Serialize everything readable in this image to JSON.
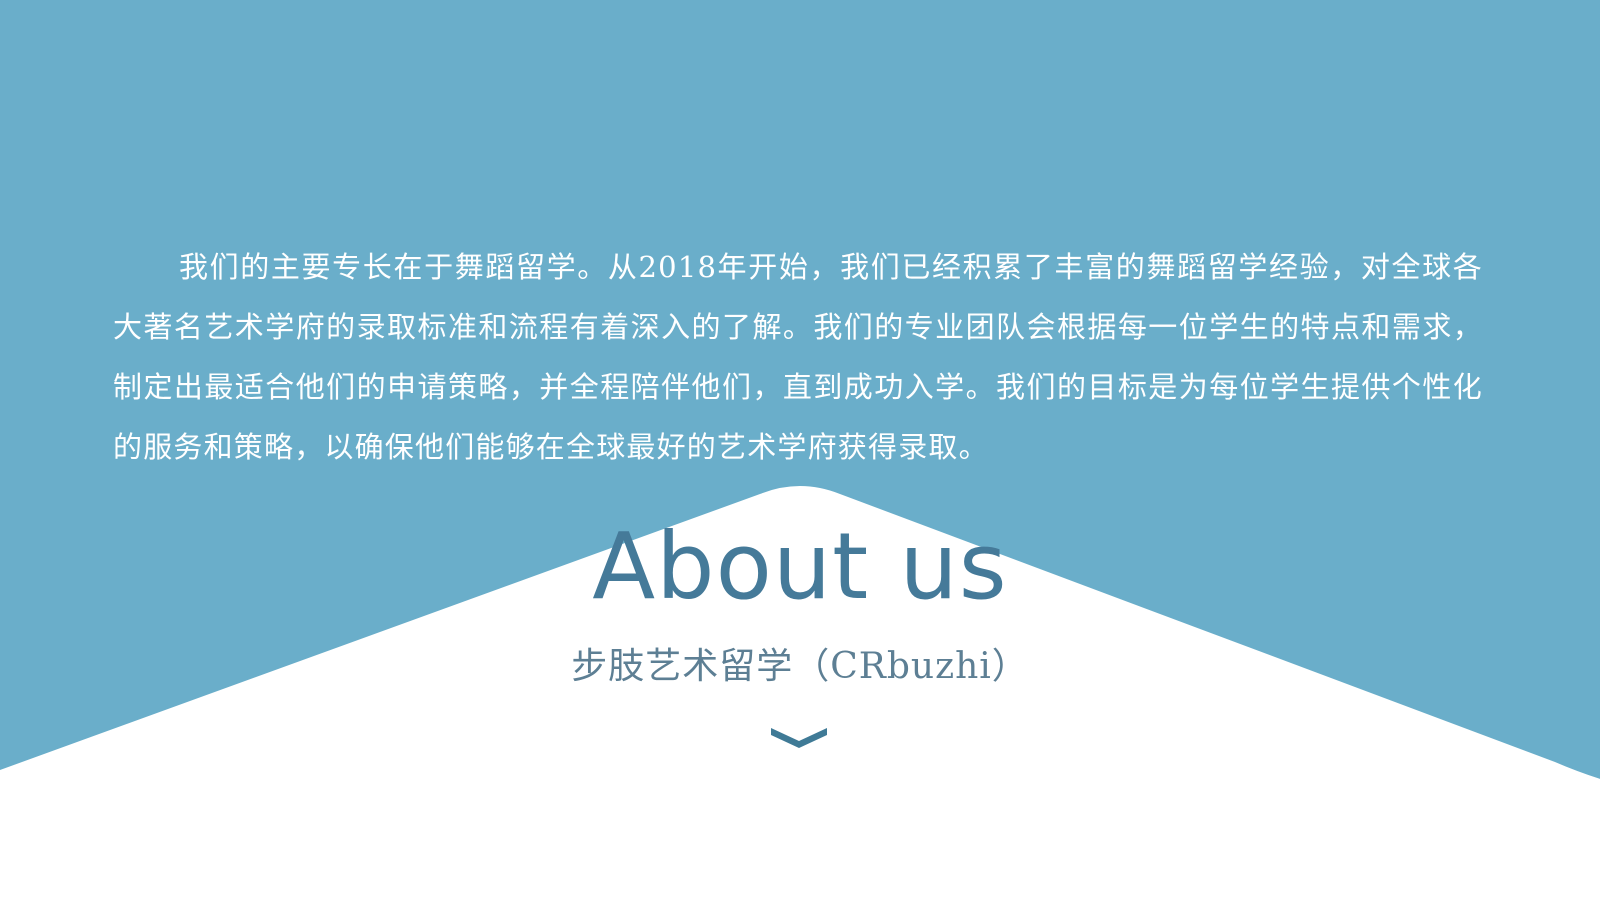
{
  "colors": {
    "background_blue": "#6aaeca",
    "foreground_white": "#ffffff",
    "title_color": "#457a99",
    "subtitle_color": "#5d7f94",
    "chevron_color": "#3f7a96"
  },
  "intro": {
    "text": "我们的主要专长在于舞蹈留学。从2018年开始，我们已经积累了丰富的舞蹈留学经验，对全球各大著名艺术学府的录取标准和流程有着深入的了解。我们的专业团队会根据每一位学生的特点和需求，制定出最适合他们的申请策略，并全程陪伴他们，直到成功入学。我们的目标是为每位学生提供个性化的服务和策略，以确保他们能够在全球最好的艺术学府获得录取。"
  },
  "about": {
    "title": "About us",
    "subtitle": "步肢艺术留学（CRbuzhi）"
  },
  "icons": {
    "scroll_indicator": "chevron-down-icon"
  }
}
